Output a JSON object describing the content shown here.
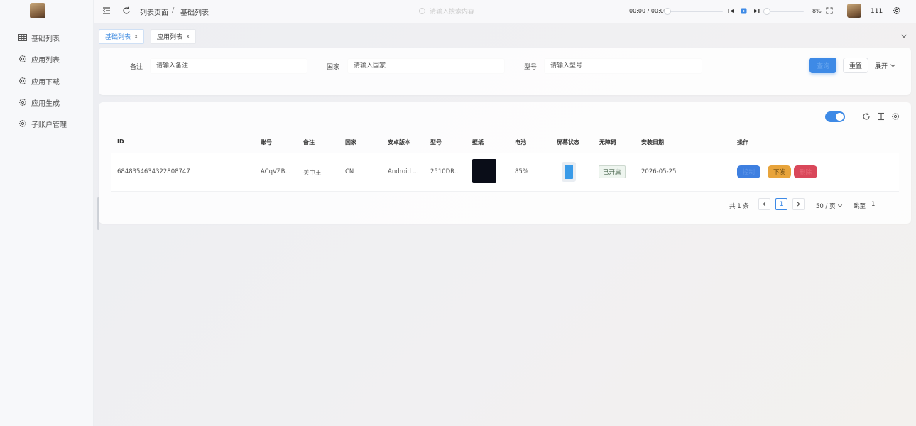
{
  "sidebar": {
    "items": [
      {
        "label": "基础列表",
        "icon": "table-grid-icon"
      },
      {
        "label": "应用列表",
        "icon": "gear-icon"
      },
      {
        "label": "应用下载",
        "icon": "gear-icon"
      },
      {
        "label": "应用生成",
        "icon": "gear-icon"
      },
      {
        "label": "子账户管理",
        "icon": "gear-icon"
      }
    ]
  },
  "header": {
    "breadcrumb": [
      "列表页面",
      "/",
      "基础列表"
    ],
    "search_hint": "请输入搜索内容",
    "player": {
      "time": "00:00 / 00:00",
      "progress": 0,
      "volume": 8,
      "volume_text": "8%"
    },
    "user": "111"
  },
  "tabs": [
    {
      "label": "基础列表",
      "close": "x",
      "active": true
    },
    {
      "label": "应用列表",
      "close": "x",
      "active": false
    }
  ],
  "filters": {
    "remark": {
      "label": "备注",
      "placeholder": "请输入备注"
    },
    "country": {
      "label": "国家",
      "placeholder": "请输入国家"
    },
    "model": {
      "label": "型号",
      "placeholder": "请输入型号"
    },
    "query_label": "查询",
    "reset_label": "重置",
    "expand_label": "展开"
  },
  "table": {
    "columns": [
      "ID",
      "账号",
      "备注",
      "国家",
      "安卓版本",
      "型号",
      "壁纸",
      "电池",
      "屏幕状态",
      "无障碍",
      "安装日期",
      "操作"
    ],
    "rows": [
      {
        "id": "6848354634322808747",
        "account": "ACqVZB...",
        "remark": "关中王",
        "country": "CN",
        "android": "Android ...",
        "model": "2510DR...",
        "battery": "85%",
        "accessibility": "已开启",
        "install_date": "2026-05-25",
        "actions": [
          "控制",
          "下发",
          "删除"
        ]
      }
    ]
  },
  "pagination": {
    "total": "共 1 条",
    "current": "1",
    "page_size": "50 / 页",
    "goto_label": "跳至",
    "goto_value": "1"
  },
  "colors": {
    "primary": "#3e8ae6",
    "warning": "#e8a43b",
    "danger": "#d9475a",
    "success_bg": "#eef5ef"
  }
}
